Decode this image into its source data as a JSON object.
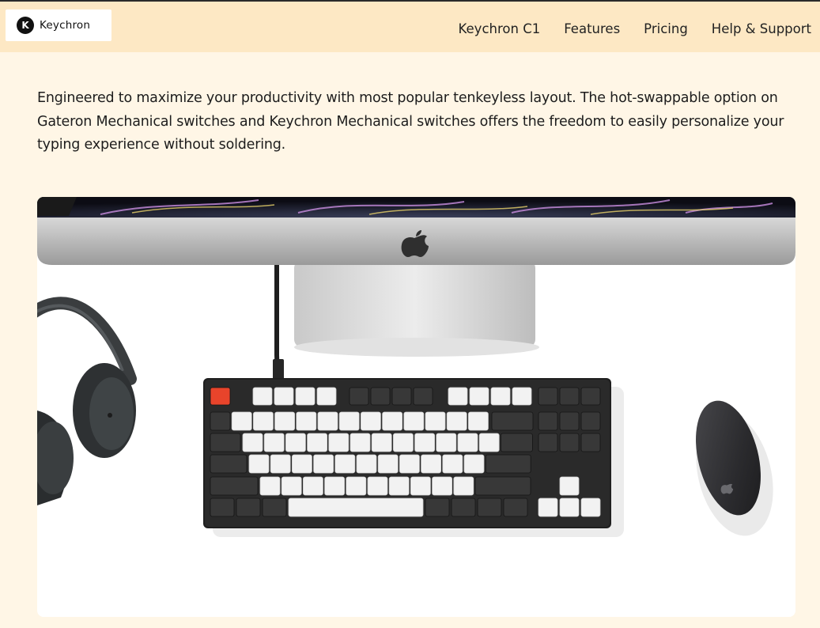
{
  "brand": {
    "name": "Keychron",
    "logo_glyph": "K"
  },
  "nav": {
    "items": [
      {
        "label": "Keychron C1"
      },
      {
        "label": "Features"
      },
      {
        "label": "Pricing"
      },
      {
        "label": "Help & Support"
      }
    ]
  },
  "intro": {
    "text": "Engineered to maximize your productivity with most popular tenkeyless layout. The hot-swappable option on Gateron Mechanical switches and Keychron Mechanical switches offers the freedom to easily personalize your typing experience without soldering."
  },
  "colors": {
    "page_bg": "#fff6e6",
    "header_bg": "#fde8c4",
    "escape_key": "#e8442b"
  }
}
